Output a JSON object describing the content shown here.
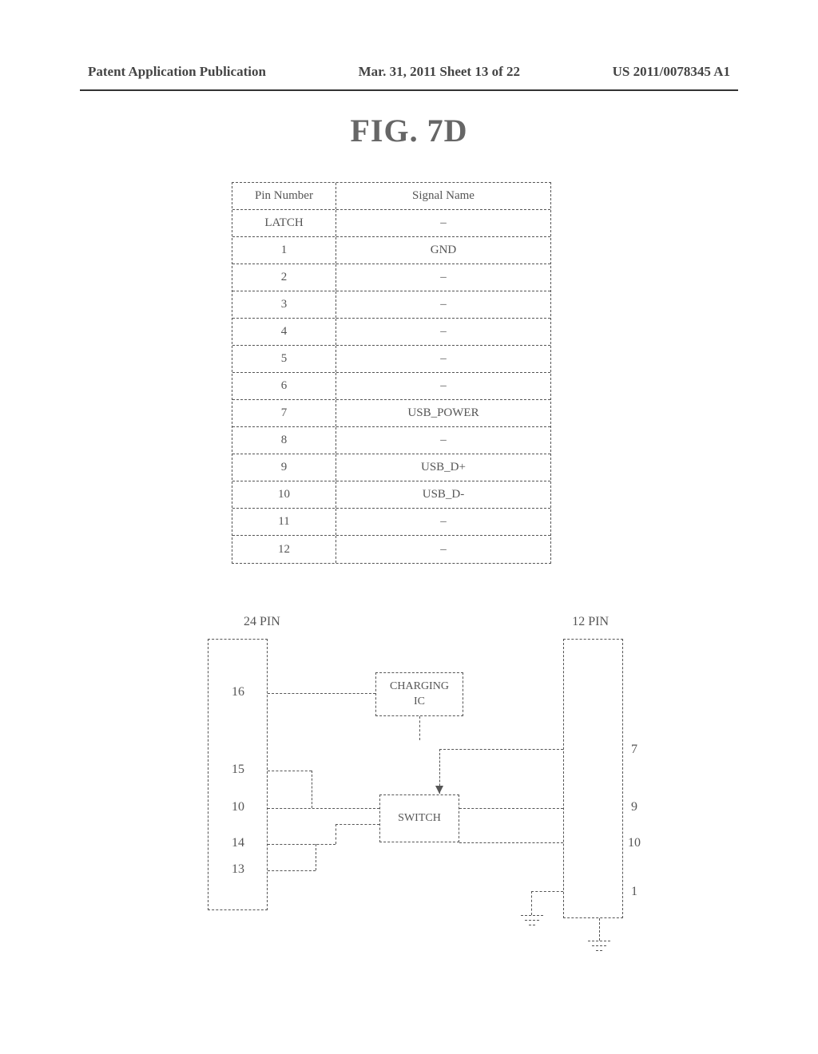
{
  "header": {
    "left": "Patent Application Publication",
    "mid": "Mar. 31, 2011  Sheet 13 of 22",
    "right": "US 2011/0078345 A1"
  },
  "figure_title": "FIG. 7D",
  "table": {
    "header": {
      "pin": "Pin Number",
      "signal": "Signal Name"
    },
    "rows": [
      {
        "pin": "LATCH",
        "signal": "‒"
      },
      {
        "pin": "1",
        "signal": "GND"
      },
      {
        "pin": "2",
        "signal": "‒"
      },
      {
        "pin": "3",
        "signal": "‒"
      },
      {
        "pin": "4",
        "signal": "‒"
      },
      {
        "pin": "5",
        "signal": "‒"
      },
      {
        "pin": "6",
        "signal": "‒"
      },
      {
        "pin": "7",
        "signal": "USB_POWER"
      },
      {
        "pin": "8",
        "signal": "‒"
      },
      {
        "pin": "9",
        "signal": "USB_D+"
      },
      {
        "pin": "10",
        "signal": "USB_D-"
      },
      {
        "pin": "11",
        "signal": "‒"
      },
      {
        "pin": "12",
        "signal": "‒"
      }
    ]
  },
  "diagram": {
    "labels": {
      "conn24": "24 PIN",
      "conn12": "12 PIN"
    },
    "blocks": {
      "charging": "CHARGING\nIC",
      "switch": "SWITCH"
    },
    "pins24": [
      "16",
      "15",
      "10",
      "14",
      "13"
    ],
    "pins12": [
      "7",
      "9",
      "10",
      "1"
    ]
  }
}
